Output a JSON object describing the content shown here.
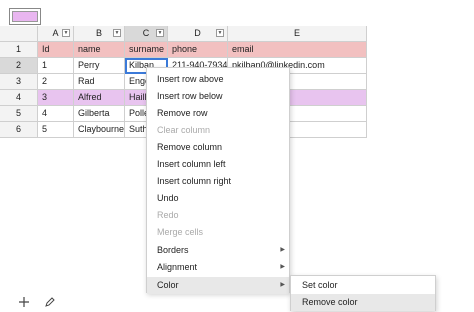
{
  "toolbar": {
    "swatch_color": "#e9b6f0",
    "swatch_icon": "color-swatch"
  },
  "columns": [
    "A",
    "B",
    "C",
    "D",
    "E"
  ],
  "rows": [
    {
      "num": "1",
      "cells": [
        "Id",
        "name",
        "surname",
        "phone",
        "email"
      ]
    },
    {
      "num": "2",
      "cells": [
        "1",
        "Perry",
        "Kilban",
        "211-940-7934",
        "pkilban0@linkedin.com"
      ]
    },
    {
      "num": "3",
      "cells": [
        "2",
        "Rad",
        "Enge",
        "",
        "edia.org"
      ]
    },
    {
      "num": "4",
      "cells": [
        "3",
        "Alfred",
        "Haill",
        "",
        "r.ru"
      ]
    },
    {
      "num": "5",
      "cells": [
        "4",
        "Gilberta",
        "Polle",
        "",
        "gov"
      ]
    },
    {
      "num": "6",
      "cells": [
        "5",
        "Claybourne",
        "Suthe",
        "",
        "ogspot.com"
      ]
    }
  ],
  "context_menu": [
    {
      "label": "Insert row above",
      "disabled": false
    },
    {
      "label": "Insert row below",
      "disabled": false
    },
    {
      "label": "Remove row",
      "disabled": false
    },
    {
      "label": "Clear column",
      "disabled": true
    },
    {
      "label": "Remove column",
      "disabled": false
    },
    {
      "label": "Insert column left",
      "disabled": false
    },
    {
      "label": "Insert column right",
      "disabled": false
    },
    {
      "label": "Undo",
      "disabled": false
    },
    {
      "label": "Redo",
      "disabled": true
    },
    {
      "label": "Merge cells",
      "disabled": true
    },
    {
      "label": "Borders",
      "disabled": false,
      "submenu": true
    },
    {
      "label": "Alignment",
      "disabled": false,
      "submenu": true
    },
    {
      "label": "Color",
      "disabled": false,
      "submenu": true,
      "highlighted": true
    }
  ],
  "color_submenu": [
    {
      "label": "Set color"
    },
    {
      "label": "Remove color",
      "highlighted": true
    }
  ],
  "bottom_bar": {
    "add_icon": "plus-icon",
    "edit_icon": "pencil-icon"
  },
  "colors": {
    "header_pink": "#f2c0c0",
    "row_lilac": "#e8c4ef",
    "selection_blue": "#3b7ad9"
  }
}
